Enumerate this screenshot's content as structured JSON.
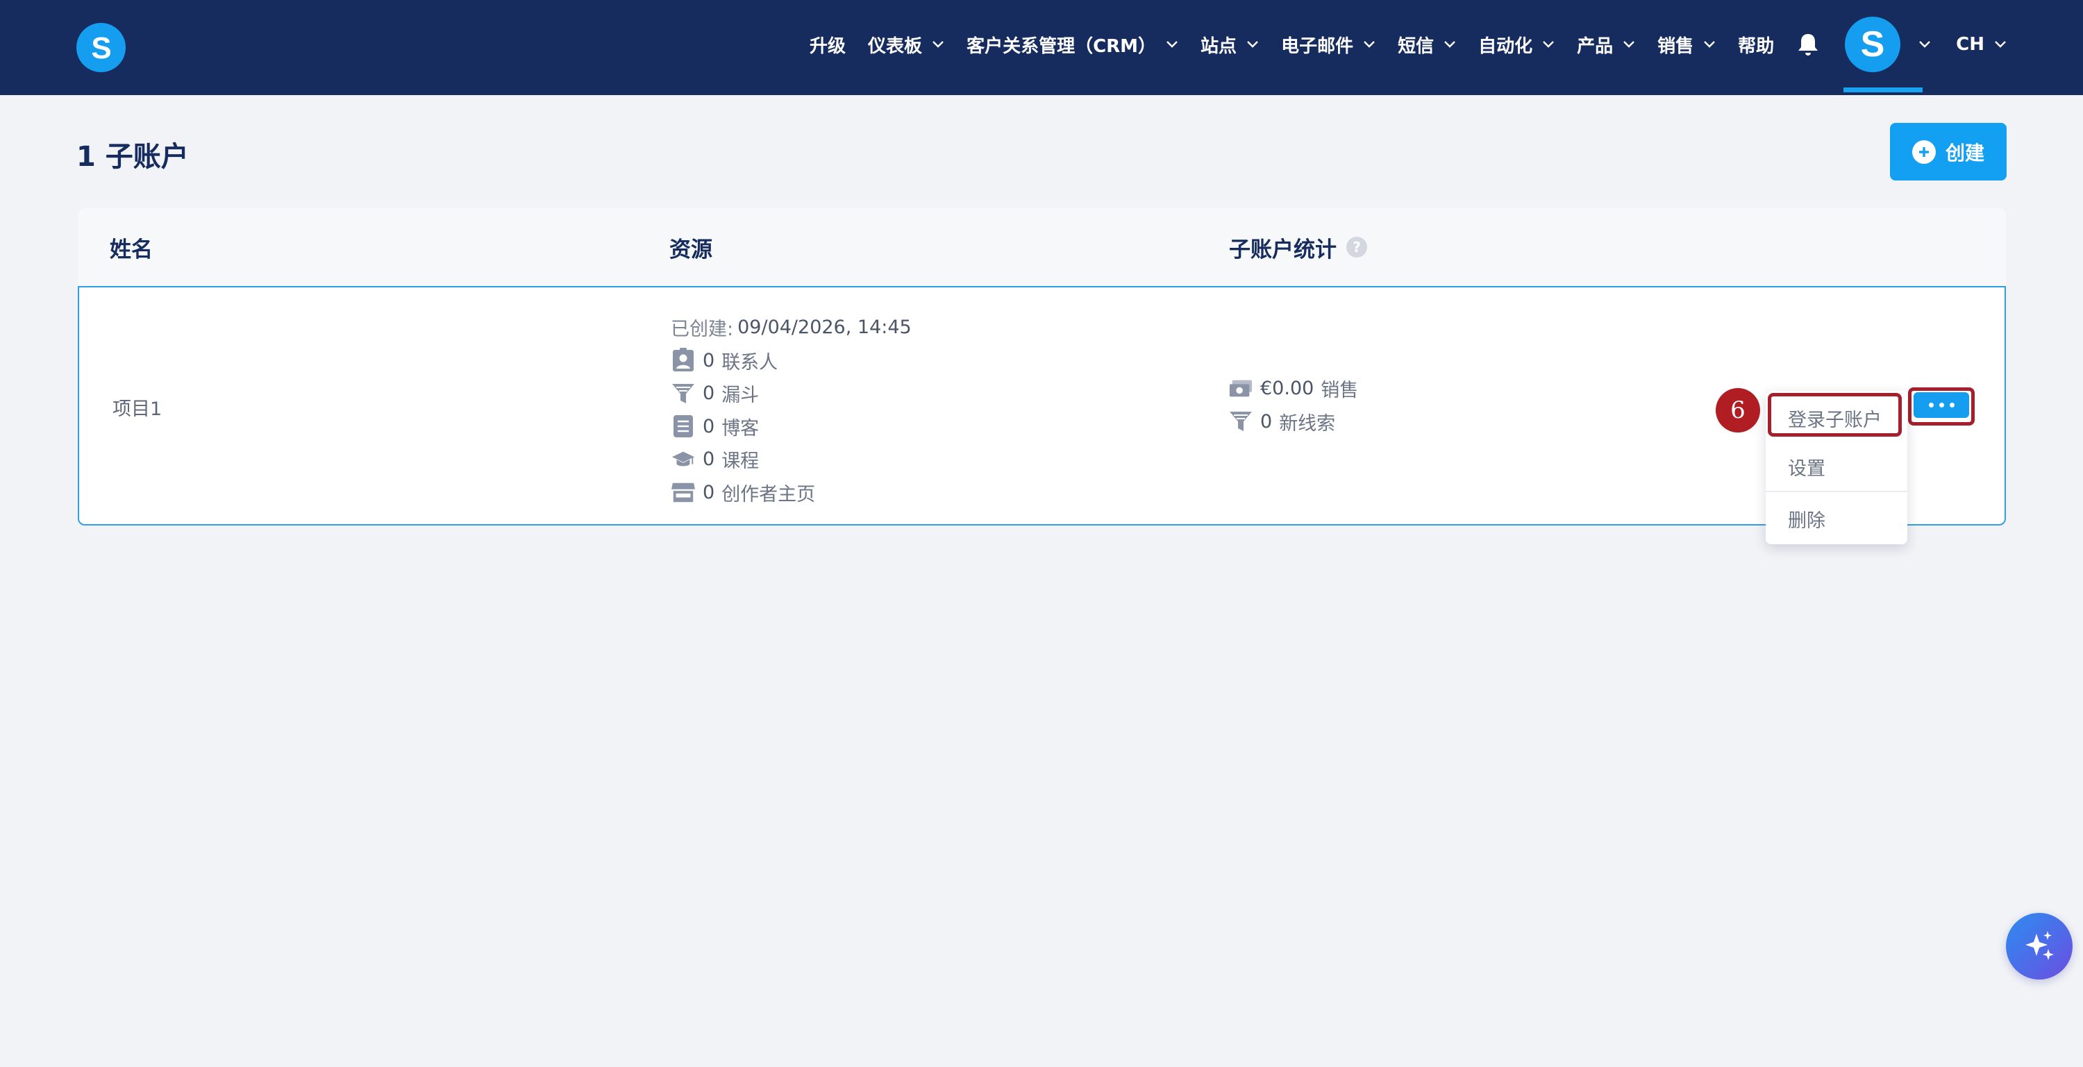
{
  "nav": {
    "logo_letter": "S",
    "items": [
      {
        "label": "升级",
        "has_dropdown": false
      },
      {
        "label": "仪表板",
        "has_dropdown": true
      },
      {
        "label": "客户关系管理（CRM）",
        "has_dropdown": true
      },
      {
        "label": "站点",
        "has_dropdown": true
      },
      {
        "label": "电子邮件",
        "has_dropdown": true
      },
      {
        "label": "短信",
        "has_dropdown": true
      },
      {
        "label": "自动化",
        "has_dropdown": true
      },
      {
        "label": "产品",
        "has_dropdown": true
      },
      {
        "label": "销售",
        "has_dropdown": true
      },
      {
        "label": "帮助",
        "has_dropdown": false
      }
    ],
    "bell_icon": "bell-icon",
    "avatar_letter": "S",
    "language": "CH"
  },
  "page": {
    "title": "1 子账户",
    "create_label": "创建"
  },
  "table": {
    "headers": {
      "name": "姓名",
      "resources": "资源",
      "stats": "子账户统计",
      "stats_help": "?"
    },
    "row": {
      "name": "项目1",
      "created_label": "已创建:",
      "created_value": "09/04/2026, 14:45",
      "resources": [
        {
          "icon": "contact-card-icon",
          "count": "0",
          "label": "联系人"
        },
        {
          "icon": "funnel-icon",
          "count": "0",
          "label": "漏斗"
        },
        {
          "icon": "blog-icon",
          "count": "0",
          "label": "博客"
        },
        {
          "icon": "graduation-cap-icon",
          "count": "0",
          "label": "课程"
        },
        {
          "icon": "storefront-icon",
          "count": "0",
          "label": "创作者主页"
        }
      ],
      "stats": [
        {
          "icon": "money-icon",
          "count": "€0.00",
          "label": "销售"
        },
        {
          "icon": "funnel-icon",
          "count": "0",
          "label": "新线索"
        }
      ]
    }
  },
  "menu": {
    "items": [
      "登录子账户",
      "设置",
      "删除"
    ]
  },
  "annotation": {
    "step": "6"
  },
  "colors": {
    "navbar": "#162c5f",
    "accent": "#159df0",
    "highlight": "#a51f2c",
    "background": "#f1f3f7"
  }
}
